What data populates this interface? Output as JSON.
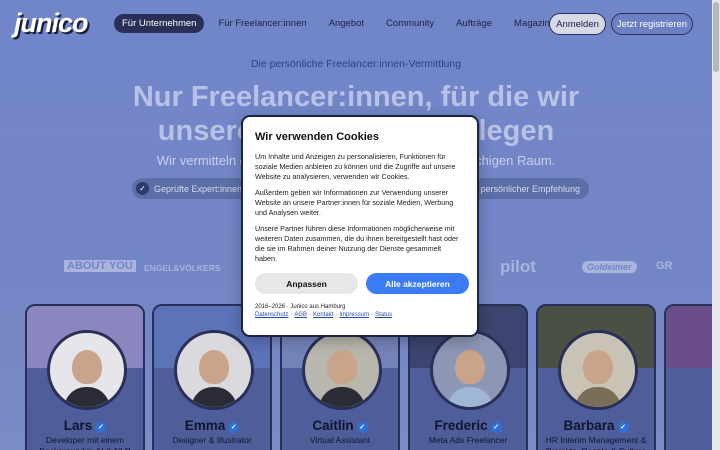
{
  "header": {
    "logo": "junico",
    "nav": [
      {
        "label": "Für Unternehmen",
        "active": true
      },
      {
        "label": "Für Freelancer:innen",
        "active": false
      },
      {
        "label": "Angebot",
        "active": false
      },
      {
        "label": "Community",
        "active": false
      },
      {
        "label": "Aufträge",
        "active": false
      },
      {
        "label": "Magazin",
        "active": false
      }
    ],
    "login_label": "Anmelden",
    "register_label": "Jetzt registrieren"
  },
  "hero": {
    "tagline": "Die persönliche Freelancer:innen-Vermittlung",
    "headline_line1": "Nur Freelancer:innen, für die wir",
    "headline_line2": "unsere Hand ins Feuer legen",
    "subline": "Wir vermitteln die Top-Freelancer:innen im deutschsprachigen Raum.",
    "pills": [
      {
        "label": "Geprüfte Expert:innen"
      },
      {
        "label": "Mit persönlicher Empfehlung"
      }
    ]
  },
  "brands": [
    "ABOUT YOU",
    "ENGEL&VÖLKERS",
    "pilot",
    "Goldeimer",
    "GR"
  ],
  "freelancers": [
    {
      "name": "Lars",
      "role": "Developer mit einem Background in AI & NLP"
    },
    {
      "name": "Emma",
      "role": "Designer & Illustrator"
    },
    {
      "name": "Caitlin",
      "role": "Virtual Assistant"
    },
    {
      "name": "Frederic",
      "role": "Meta Ads Freelancer"
    },
    {
      "name": "Barbara",
      "role": "HR Interim Management & Projekte, People & Culture"
    }
  ],
  "cookie_modal": {
    "title": "Wir verwenden Cookies",
    "paragraph1": "Um Inhalte und Anzeigen zu personalisieren, Funktionen für soziale Medien anbieten zu können und die Zugriffe auf unsere Website zu analysieren, verwenden wir Cookies.",
    "paragraph2": "Außerdem geben wir Informationen zur Verwendung unserer Website an unsere Partner:innen für soziale Medien, Werbung und Analysen weiter.",
    "paragraph3": "Unsere Partner führen diese Informationen möglicherweise mit weiteren Daten zusammen, die du ihnen bereitgestellt hast oder die sie im Rahmen deiner Nutzung der Dienste gesammelt haben.",
    "adjust_label": "Anpassen",
    "accept_label": "Alle akzeptieren",
    "footer": "2016–2026 · Junico aus Hamburg",
    "links": [
      "Datenschutz",
      "AGB",
      "Kontakt",
      "Impressum",
      "Status"
    ]
  },
  "colors": {
    "background": "#7186c9",
    "navy": "#2a2f57",
    "accent": "#3b7bf6"
  }
}
